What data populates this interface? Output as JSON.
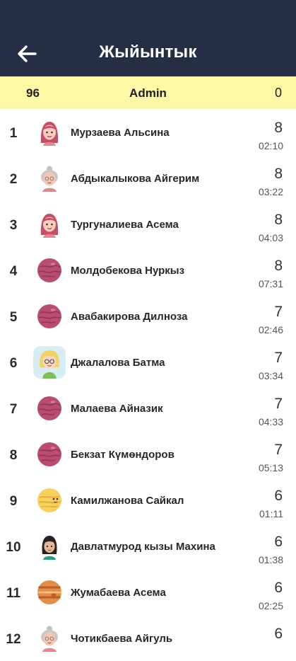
{
  "header": {
    "title": "Жыйынтык",
    "back_icon": "arrow-left-icon"
  },
  "current_user": {
    "rank": "96",
    "name": "Admin",
    "score": "0"
  },
  "rows": [
    {
      "rank": "1",
      "name": "Мурзаева Альсина",
      "score": "8",
      "time": "02:10",
      "avatar": "girl-avatar-icon"
    },
    {
      "rank": "2",
      "name": "Абдыкалыкова Айгерим",
      "score": "8",
      "time": "03:22",
      "avatar": "grandma-avatar-icon"
    },
    {
      "rank": "3",
      "name": "Тургуналиева Асема",
      "score": "8",
      "time": "04:03",
      "avatar": "girl-avatar-icon"
    },
    {
      "rank": "4",
      "name": "Молдобекова Нуркыз",
      "score": "8",
      "time": "07:31",
      "avatar": "planet-avatar-icon"
    },
    {
      "rank": "5",
      "name": "Авабакирова Дилноза",
      "score": "7",
      "time": "02:46",
      "avatar": "planet-avatar-icon"
    },
    {
      "rank": "6",
      "name": "Джалалова Батма",
      "score": "7",
      "time": "03:34",
      "avatar": "blonde-avatar-icon"
    },
    {
      "rank": "7",
      "name": "Малаева Айназик",
      "score": "7",
      "time": "04:33",
      "avatar": "planet-avatar-icon"
    },
    {
      "rank": "8",
      "name": "Бекзат Күмөндоров",
      "score": "7",
      "time": "05:13",
      "avatar": "planet-avatar-icon"
    },
    {
      "rank": "9",
      "name": "Камилжанова Сайкал",
      "score": "6",
      "time": "01:11",
      "avatar": "sun-avatar-icon"
    },
    {
      "rank": "10",
      "name": "Давлатмурод кызы Махина",
      "score": "6",
      "time": "01:38",
      "avatar": "dark-hair-avatar-icon"
    },
    {
      "rank": "11",
      "name": "Жумабаева Асема",
      "score": "6",
      "time": "02:25",
      "avatar": "jupiter-avatar-icon"
    },
    {
      "rank": "12",
      "name": "Чотикбаева Айгуль",
      "score": "6",
      "time": "",
      "avatar": "grandma-avatar-icon"
    }
  ]
}
